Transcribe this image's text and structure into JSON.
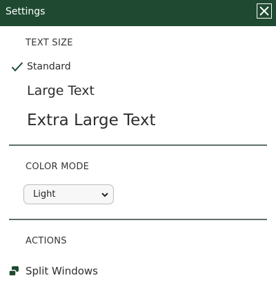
{
  "window": {
    "title": "Settings",
    "close_icon": "close-icon",
    "header_color": "#1f4a31"
  },
  "text_size": {
    "heading": "TEXT SIZE",
    "selected": "Standard",
    "check_icon": "checkmark-icon",
    "options": [
      {
        "label": "Standard",
        "selected": true
      },
      {
        "label": "Large Text",
        "selected": false
      },
      {
        "label": "Extra Large Text",
        "selected": false
      }
    ]
  },
  "color_mode": {
    "heading": "COLOR MODE",
    "selected": "Light",
    "chevron_icon": "chevron-down-icon"
  },
  "actions": {
    "heading": "ACTIONS",
    "items": [
      {
        "label": "Split Windows",
        "icon": "split-windows-icon"
      }
    ]
  }
}
